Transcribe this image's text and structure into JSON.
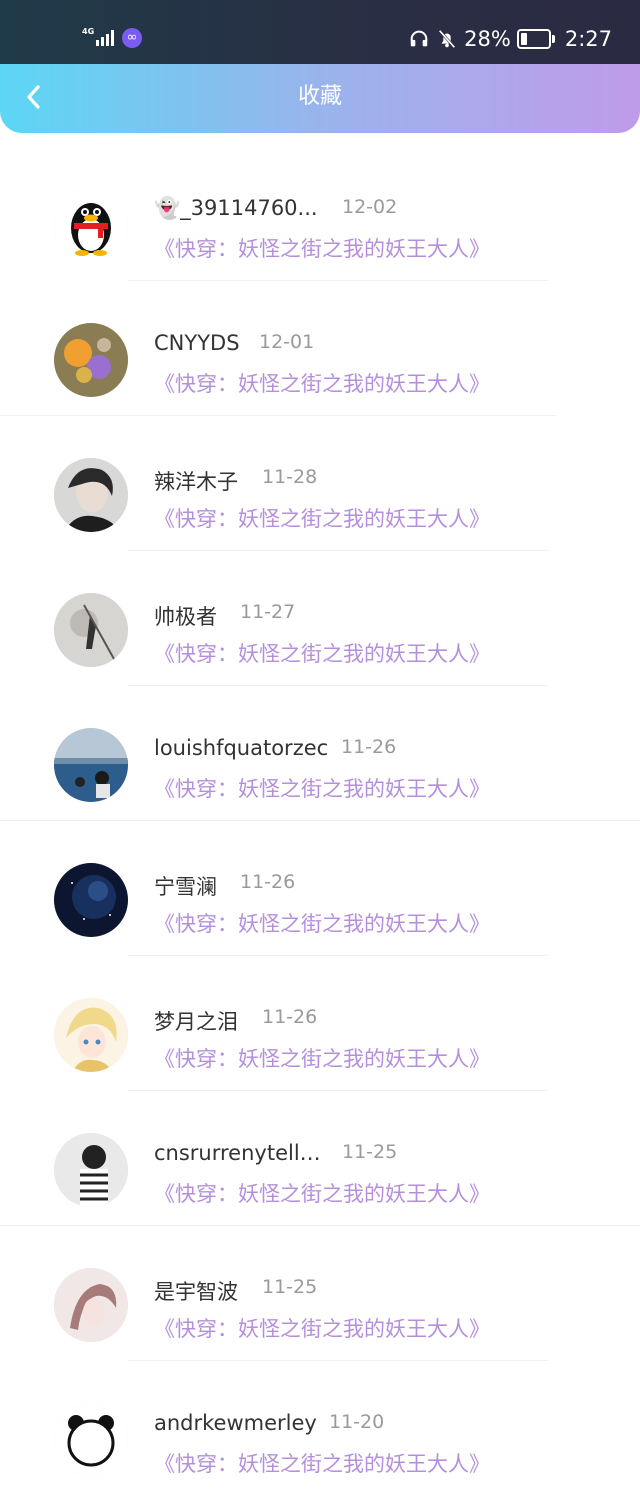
{
  "status_bar": {
    "network": "4G",
    "battery": "28%",
    "time": "2:27"
  },
  "header": {
    "title": "收藏"
  },
  "favorites": [
    {
      "name": "👻_39114760...",
      "date": "12-02",
      "book": "《快穿：妖怪之街之我的妖王大人》",
      "avatar": "penguin-avatar"
    },
    {
      "name": "CNYYDS",
      "date": "12-01",
      "book": "《快穿：妖怪之街之我的妖王大人》",
      "avatar": "flowers-avatar"
    },
    {
      "name": "辣洋木子",
      "date": "11-28",
      "book": "《快穿：妖怪之街之我的妖王大人》",
      "avatar": "portrait-avatar"
    },
    {
      "name": "帅极者",
      "date": "11-27",
      "book": "《快穿：妖怪之街之我的妖王大人》",
      "avatar": "warrior-avatar"
    },
    {
      "name": "louishfquatorzec",
      "date": "11-26",
      "book": "《快穿：妖怪之街之我的妖王大人》",
      "avatar": "sea-avatar"
    },
    {
      "name": "宁雪澜",
      "date": "11-26",
      "book": "《快穿：妖怪之街之我的妖王大人》",
      "avatar": "galaxy-avatar"
    },
    {
      "name": "梦月之泪",
      "date": "11-26",
      "book": "《快穿：妖怪之街之我的妖王大人》",
      "avatar": "anime-avatar"
    },
    {
      "name": "cnsrurrenytelli...",
      "date": "11-25",
      "book": "《快穿：妖怪之街之我的妖王大人》",
      "avatar": "striped-avatar"
    },
    {
      "name": "是宇智波",
      "date": "11-25",
      "book": "《快穿：妖怪之街之我的妖王大人》",
      "avatar": "sketch-avatar"
    },
    {
      "name": "andrkewmerley",
      "date": "11-20",
      "book": "《快穿：妖怪之街之我的妖王大人》",
      "avatar": "panda-avatar"
    }
  ]
}
